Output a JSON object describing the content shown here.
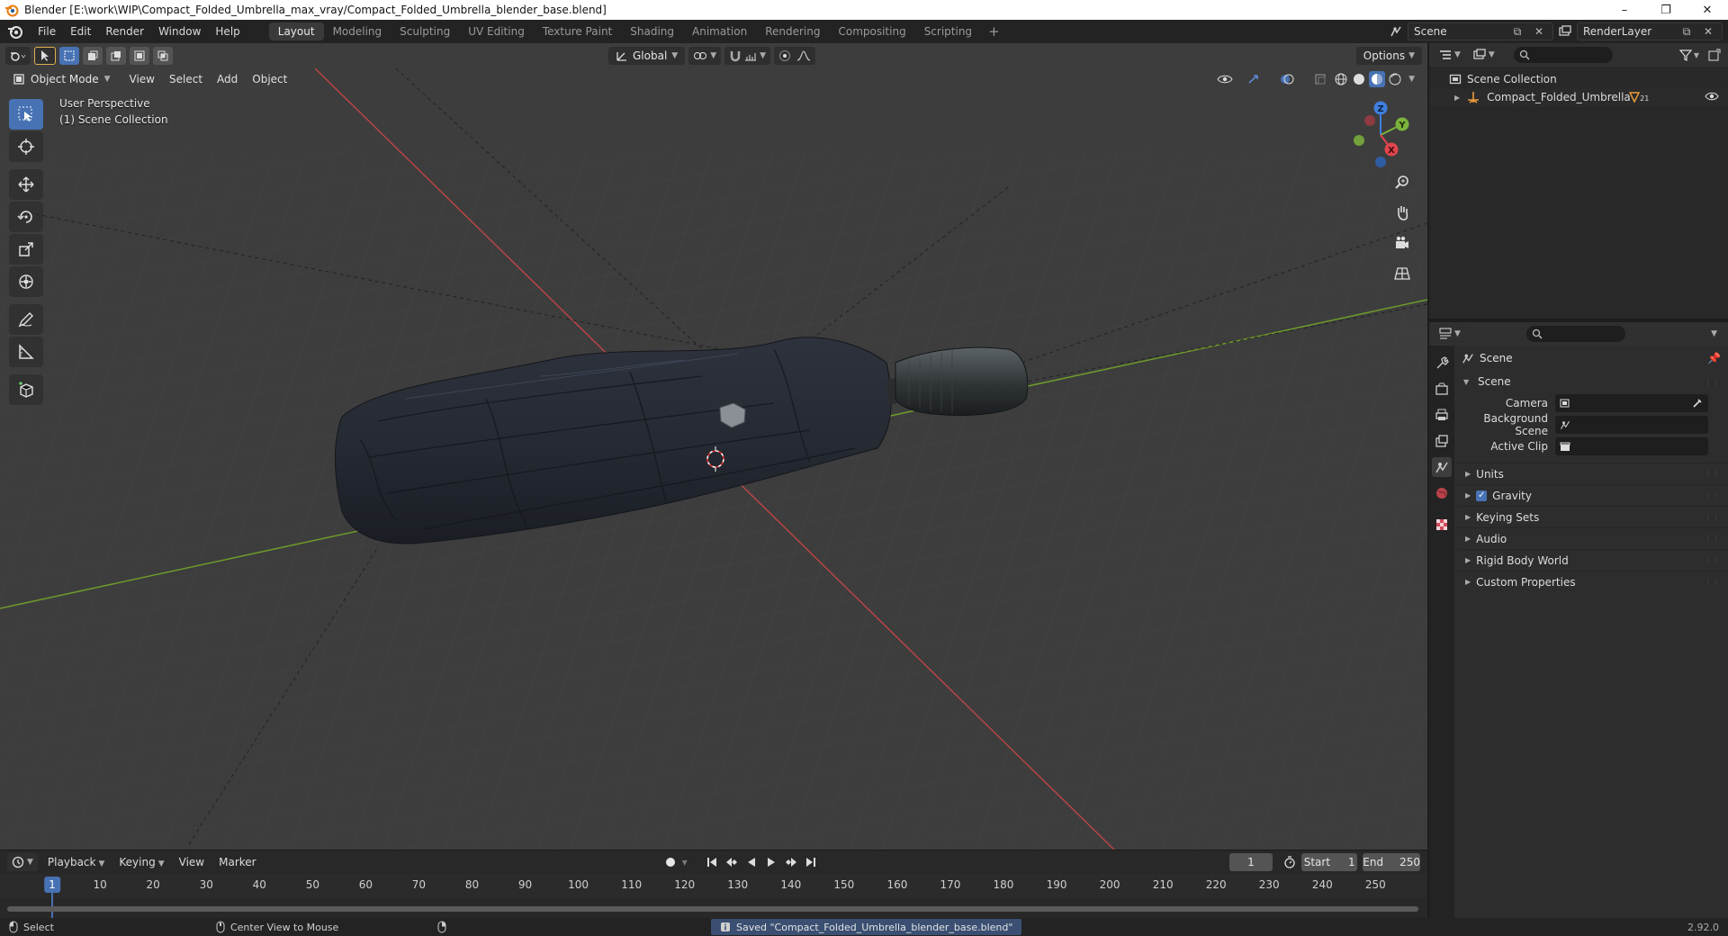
{
  "window": {
    "title": "Blender [E:\\work\\WIP\\Compact_Folded_Umbrella_max_vray/Compact_Folded_Umbrella_blender_base.blend]",
    "controls": [
      "–",
      "❐",
      "✕"
    ]
  },
  "menubar": {
    "items": [
      "File",
      "Edit",
      "Render",
      "Window",
      "Help"
    ],
    "workspaces": [
      "Layout",
      "Modeling",
      "Sculpting",
      "UV Editing",
      "Texture Paint",
      "Shading",
      "Animation",
      "Rendering",
      "Compositing",
      "Scripting"
    ],
    "active_workspace": "Layout",
    "add_tab": "+",
    "scene_name": "Scene",
    "view_layer": "RenderLayer"
  },
  "viewport": {
    "orientation": "Global",
    "options_label": "Options",
    "mode": "Object Mode",
    "menus": [
      "View",
      "Select",
      "Add",
      "Object"
    ],
    "perspective_label": "User Perspective",
    "collection_label": "(1) Scene Collection",
    "gizmo_axes": {
      "x": "X",
      "y": "Y",
      "z": "Z"
    },
    "colors": {
      "background": "#3d3d3d",
      "x_axis": "#c84545",
      "y_axis": "#7ea23a",
      "active": "#4772b3"
    }
  },
  "outliner": {
    "root": "Scene Collection",
    "items": [
      {
        "name": "Compact_Folded_Umbrella",
        "badge": "21"
      }
    ]
  },
  "properties": {
    "context": "Scene",
    "panel": "Scene",
    "fields": [
      {
        "label": "Camera",
        "value": ""
      },
      {
        "label": "Background Scene",
        "value": ""
      },
      {
        "label": "Active Clip",
        "value": ""
      }
    ],
    "subpanels": [
      "Units",
      "Gravity",
      "Keying Sets",
      "Audio",
      "Rigid Body World",
      "Custom Properties"
    ],
    "gravity_enabled": true
  },
  "timeline": {
    "menus": [
      "Playback",
      "Keying",
      "View",
      "Marker"
    ],
    "current_frame": "1",
    "start_label": "Start",
    "start": "1",
    "end_label": "End",
    "end": "250",
    "ticks": [
      "1",
      "10",
      "20",
      "30",
      "40",
      "50",
      "60",
      "70",
      "80",
      "90",
      "100",
      "110",
      "120",
      "130",
      "140",
      "150",
      "160",
      "170",
      "180",
      "190",
      "200",
      "210",
      "220",
      "230",
      "240",
      "250"
    ]
  },
  "statusbar": {
    "select": "Select",
    "center_view": "Center View to Mouse",
    "saved_message": "Saved \"Compact_Folded_Umbrella_blender_base.blend\"",
    "version": "2.92.0"
  }
}
